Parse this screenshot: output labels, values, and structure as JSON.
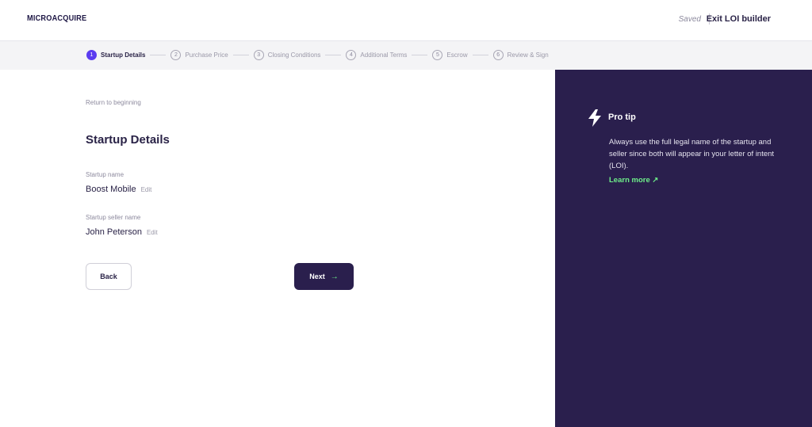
{
  "header": {
    "logo": "MICROACQUIRE",
    "saved": "Saved",
    "exit": "Exit LOI builder"
  },
  "steps": [
    {
      "num": "1",
      "label": "Startup Details",
      "active": true
    },
    {
      "num": "2",
      "label": "Purchase Price",
      "active": false
    },
    {
      "num": "3",
      "label": "Closing Conditions",
      "active": false
    },
    {
      "num": "4",
      "label": "Additional Terms",
      "active": false
    },
    {
      "num": "5",
      "label": "Escrow",
      "active": false
    },
    {
      "num": "6",
      "label": "Review & Sign",
      "active": false
    }
  ],
  "main": {
    "return_link": "Return to beginning",
    "title": "Startup Details",
    "fields": [
      {
        "label": "Startup name",
        "value": "Boost Mobile",
        "edit": "Edit"
      },
      {
        "label": "Startup seller name",
        "value": "John Peterson",
        "edit": "Edit"
      }
    ],
    "back_label": "Back",
    "next_label": "Next",
    "next_arrow": "→"
  },
  "sidebar": {
    "icon": "lightning-bolt-icon",
    "title": "Pro tip",
    "text": "Always use the full legal name of the startup and seller since both will appear in your letter of intent (LOI).",
    "link": "Learn more ↗"
  },
  "colors": {
    "accent": "#5b3cf0",
    "dark": "#2a1f4d",
    "link_green": "#6ef08a"
  }
}
